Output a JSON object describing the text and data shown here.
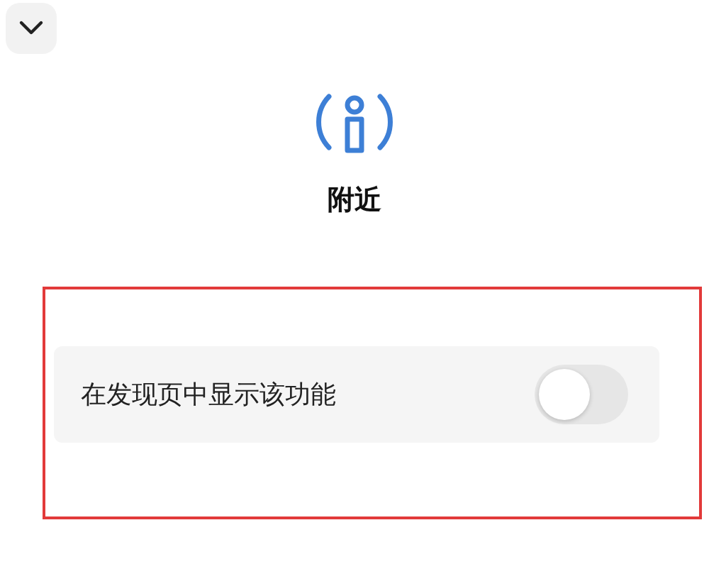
{
  "header": {
    "title": "附近"
  },
  "settings": [
    {
      "label": "在发现页中显示该功能",
      "on": false,
      "highlighted": true
    }
  ]
}
